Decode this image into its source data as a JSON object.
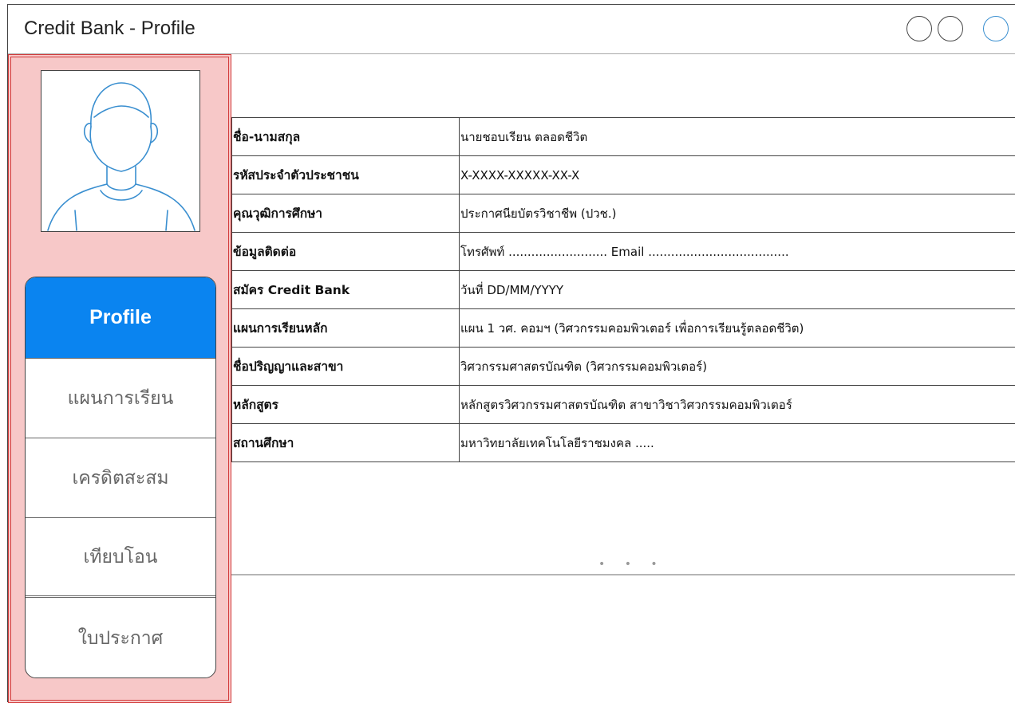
{
  "window": {
    "title": "Credit Bank - Profile"
  },
  "sidebar": {
    "avatar": "user-avatar-icon",
    "nav": [
      {
        "label": "Profile",
        "active": true
      },
      {
        "label": "แผนการเรียน",
        "active": false
      },
      {
        "label": "เครดิตสะสม",
        "active": false
      },
      {
        "label": "เทียบโอน",
        "active": false
      },
      {
        "label": "ใบประกาศ",
        "active": false
      }
    ]
  },
  "profile": {
    "rows": [
      {
        "label": "ชื่อ-นามสกุล",
        "value": "นายชอบเรียน  ตลอดชีวิต"
      },
      {
        "label": "รหัสประจำตัวประชาชน",
        "value": "X-XXXX-XXXXX-XX-X"
      },
      {
        "label": "คุณวุฒิการศึกษา",
        "value": "ประกาศนียบัตรวิชาชีพ (ปวช.)"
      },
      {
        "label": "ข้อมูลติดต่อ",
        "value": "โทรศัพท์ .......................... Email ....................................."
      },
      {
        "label": "สมัคร Credit Bank",
        "value": "วันที่ DD/MM/YYYY"
      },
      {
        "label": "แผนการเรียนหลัก",
        "value": "แผน 1 วศ. คอมฯ (วิศวกรรมคอมพิวเตอร์ เพื่อการเรียนรู้ตลอดชีวิต)"
      },
      {
        "label": "ชื่อปริญญาและสาขา",
        "value": "วิศวกรรมศาสตรบัณฑิต (วิศวกรรมคอมพิวเตอร์)"
      },
      {
        "label": "หลักสูตร",
        "value": "หลักสูตรวิศวกรรมศาสตรบัณฑิต สาขาวิชาวิศวกรรมคอมพิวเตอร์"
      },
      {
        "label": "สถานศึกษา",
        "value": "มหาวิทยาลัยเทคโนโลยีราชมงคล ....."
      }
    ],
    "more_indicator": "• • •"
  },
  "colors": {
    "sidebar_bg": "#f7c8c8",
    "sidebar_border": "#d23b3b",
    "active_tab": "#0a84f0",
    "avatar_stroke": "#3a8fd0"
  }
}
